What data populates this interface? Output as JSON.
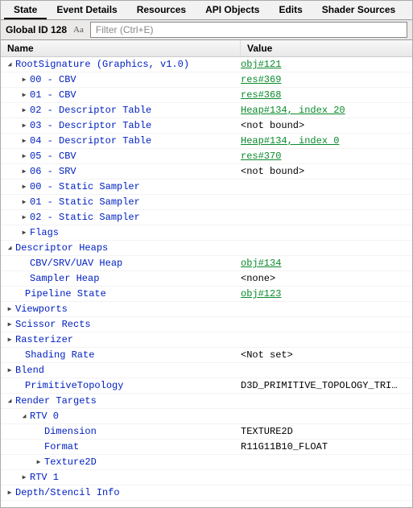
{
  "tabs": {
    "items": [
      "State",
      "Event Details",
      "Resources",
      "API Objects",
      "Edits",
      "Shader Sources"
    ],
    "active_index": 0
  },
  "toolbar": {
    "global_id_label": "Global ID 128",
    "filter_placeholder": "Filter (Ctrl+E)"
  },
  "columns": {
    "name": "Name",
    "value": "Value"
  },
  "rows": [
    {
      "depth": 0,
      "name": "RootSignature (Graphics, v1.0)",
      "value": "obj#121",
      "value_kind": "link",
      "arrow": "down"
    },
    {
      "depth": 1,
      "name": "00 - CBV",
      "value": "res#369",
      "value_kind": "link",
      "arrow": "right"
    },
    {
      "depth": 1,
      "name": "01 - CBV",
      "value": "res#368",
      "value_kind": "link",
      "arrow": "right"
    },
    {
      "depth": 1,
      "name": "02 - Descriptor Table",
      "value": "Heap#134, index 20",
      "value_kind": "link",
      "arrow": "right"
    },
    {
      "depth": 1,
      "name": "03 - Descriptor Table",
      "value": "<not bound>",
      "value_kind": "plain",
      "arrow": "right"
    },
    {
      "depth": 1,
      "name": "04 - Descriptor Table",
      "value": "Heap#134, index 0",
      "value_kind": "link",
      "arrow": "right"
    },
    {
      "depth": 1,
      "name": "05 - CBV",
      "value": "res#370",
      "value_kind": "link",
      "arrow": "right"
    },
    {
      "depth": 1,
      "name": "06 - SRV",
      "value": "<not bound>",
      "value_kind": "plain",
      "arrow": "right"
    },
    {
      "depth": 1,
      "name": "00 - Static Sampler",
      "value": "",
      "value_kind": "plain",
      "arrow": "right"
    },
    {
      "depth": 1,
      "name": "01 - Static Sampler",
      "value": "",
      "value_kind": "plain",
      "arrow": "right"
    },
    {
      "depth": 1,
      "name": "02 - Static Sampler",
      "value": "",
      "value_kind": "plain",
      "arrow": "right"
    },
    {
      "depth": 1,
      "name": "Flags",
      "value": "",
      "value_kind": "plain",
      "arrow": "right"
    },
    {
      "depth": 0,
      "name": "Descriptor Heaps",
      "value": "",
      "value_kind": "plain",
      "arrow": "down"
    },
    {
      "depth": 1,
      "name": "CBV/SRV/UAV Heap",
      "value": "obj#134",
      "value_kind": "link",
      "arrow": "none"
    },
    {
      "depth": 1,
      "name": "Sampler Heap",
      "value": "<none>",
      "value_kind": "plain",
      "arrow": "none"
    },
    {
      "depth": 0,
      "name": "Pipeline State",
      "value": "obj#123",
      "value_kind": "link",
      "arrow": "none",
      "extra_indent": 1
    },
    {
      "depth": 0,
      "name": "Viewports",
      "value": "",
      "value_kind": "plain",
      "arrow": "right"
    },
    {
      "depth": 0,
      "name": "Scissor Rects",
      "value": "",
      "value_kind": "plain",
      "arrow": "right"
    },
    {
      "depth": 0,
      "name": "Rasterizer",
      "value": "",
      "value_kind": "plain",
      "arrow": "right"
    },
    {
      "depth": 0,
      "name": "Shading Rate",
      "value": "<Not set>",
      "value_kind": "plain",
      "arrow": "none",
      "extra_indent": 1
    },
    {
      "depth": 0,
      "name": "Blend",
      "value": "",
      "value_kind": "plain",
      "arrow": "right"
    },
    {
      "depth": 0,
      "name": "PrimitiveTopology",
      "value": "D3D_PRIMITIVE_TOPOLOGY_TRI…",
      "value_kind": "plain",
      "arrow": "none",
      "extra_indent": 1
    },
    {
      "depth": 0,
      "name": "Render Targets",
      "value": "",
      "value_kind": "plain",
      "arrow": "down"
    },
    {
      "depth": 1,
      "name": "RTV 0",
      "value": "",
      "value_kind": "plain",
      "arrow": "down"
    },
    {
      "depth": 2,
      "name": "Dimension",
      "value": "TEXTURE2D",
      "value_kind": "plain",
      "arrow": "none"
    },
    {
      "depth": 2,
      "name": "Format",
      "value": "R11G11B10_FLOAT",
      "value_kind": "plain",
      "arrow": "none"
    },
    {
      "depth": 2,
      "name": "Texture2D",
      "value": "",
      "value_kind": "plain",
      "arrow": "right"
    },
    {
      "depth": 1,
      "name": "RTV 1",
      "value": "",
      "value_kind": "plain",
      "arrow": "right"
    },
    {
      "depth": 0,
      "name": "Depth/Stencil Info",
      "value": "",
      "value_kind": "plain",
      "arrow": "right"
    }
  ]
}
